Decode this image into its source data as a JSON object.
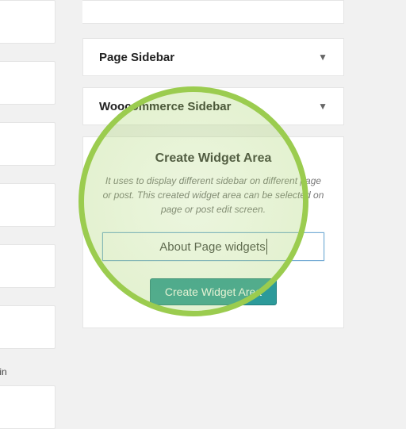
{
  "left": {
    "note": "s in"
  },
  "accordions": [
    {
      "title": "Page Sidebar"
    },
    {
      "title": "Woocommerce Sidebar"
    }
  ],
  "panel": {
    "heading": "Create Widget Area",
    "description": "It uses to display different sidebar on different page or post. This created widget area can be selected on page or post edit screen.",
    "input_value": "About Page widgets",
    "button_label": "Create Widget Area"
  }
}
